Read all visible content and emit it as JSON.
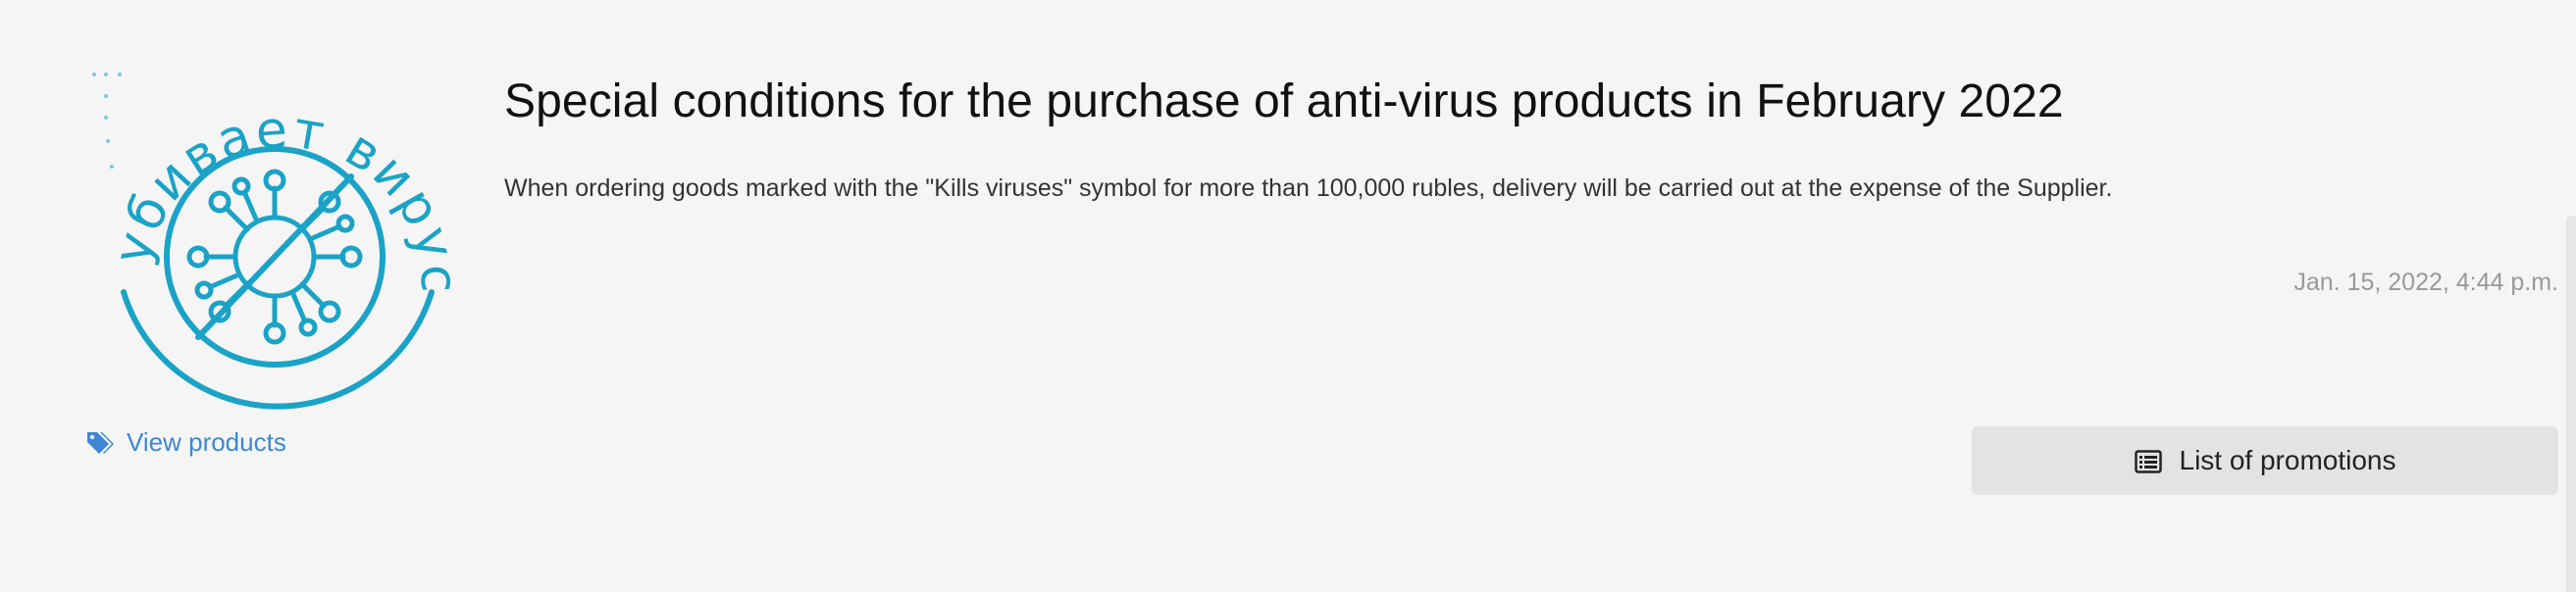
{
  "logo": {
    "alt": "убивает вирусы",
    "arc_text": "убивает вирусы",
    "color": "#1aa3c6"
  },
  "view_products": {
    "label": "View products",
    "icon": "tags-icon",
    "color": "#3d87d4"
  },
  "promotion": {
    "title": "Special conditions for the purchase of anti-virus products in February 2022",
    "description": "When ordering goods marked with the \"Kills viruses\" symbol for more than 100,000 rubles, delivery will be carried out at the expense of the Supplier.",
    "date": "Jan. 15, 2022, 4:44 p.m."
  },
  "actions": {
    "list_promotions_label": "List of promotions",
    "list_icon": "list-icon"
  }
}
